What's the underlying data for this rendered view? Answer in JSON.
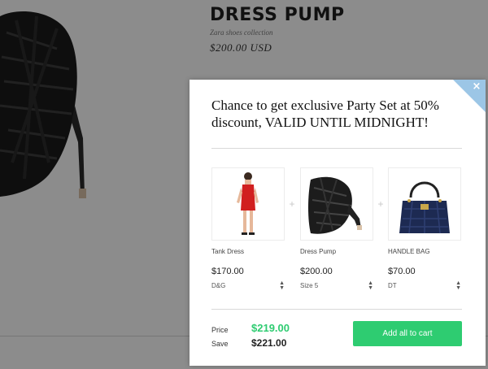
{
  "product": {
    "title": "DRESS PUMP",
    "collection": "Zara shoes collection",
    "price": "$200.00 USD"
  },
  "modal": {
    "headline": "Chance to get exclusive Party Set at 50% discount, VALID UNTIL MIDNIGHT!",
    "close_icon": "×",
    "plus_sign": "+",
    "items": [
      {
        "name": "Tank Dress",
        "price": "$170.00",
        "variant": "D&G",
        "image_icon": "red-dress-model-image"
      },
      {
        "name": "Dress Pump",
        "price": "$200.00",
        "variant": "Size 5",
        "image_icon": "black-heel-shoe-image"
      },
      {
        "name": "HANDLE BAG",
        "price": "$70.00",
        "variant": "DT",
        "image_icon": "navy-handbag-image"
      }
    ],
    "summary": {
      "price_label": "Price",
      "price_value": "$219.00",
      "save_label": "Save",
      "save_value": "$221.00"
    },
    "add_all_label": "Add all to cart"
  },
  "colors": {
    "accent_green": "#2ecc71",
    "corner_blue": "#9cc6e6",
    "overlay": "rgba(0,0,0,0.45)"
  }
}
